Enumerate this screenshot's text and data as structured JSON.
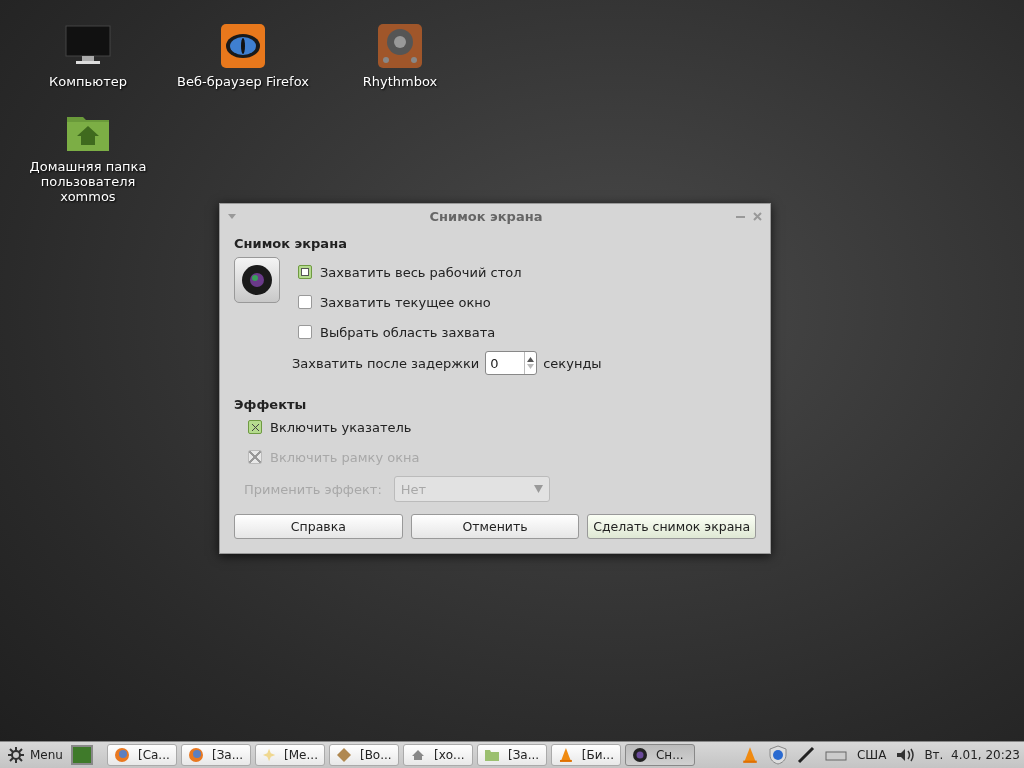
{
  "desktop_icons": [
    {
      "kind": "monitor",
      "label": "Компьютер"
    },
    {
      "kind": "browser",
      "label": "Веб-браузер Firefox"
    },
    {
      "kind": "speaker",
      "label": "Rhythmbox"
    },
    {
      "kind": "home",
      "label": "Домашняя папка пользователя xommos"
    }
  ],
  "dialog": {
    "title": "Снимок экрана",
    "section_capture": "Снимок экрана",
    "capture_options": [
      {
        "label": "Захватить весь рабочий стол",
        "selected": true
      },
      {
        "label": "Захватить текущее окно",
        "selected": false
      },
      {
        "label": "Выбрать область захвата",
        "selected": false
      }
    ],
    "delay_label": "Захватить после задержки",
    "delay_value": "0",
    "delay_unit": "секунды",
    "section_effects": "Эффекты",
    "effects": [
      {
        "label": "Включить указатель",
        "checked": true,
        "disabled": false
      },
      {
        "label": "Включить рамку окна",
        "checked": true,
        "disabled": true
      }
    ],
    "effect_label": "Применить эффект:",
    "effect_value": "Нет",
    "effect_disabled": true,
    "buttons": [
      {
        "label": "Справка",
        "default": false
      },
      {
        "label": "Отменить",
        "default": false
      },
      {
        "label": "Сделать снимок экрана",
        "default": true
      }
    ]
  },
  "taskbar": {
    "menu_label": "Menu",
    "tasks": [
      {
        "kind": "browser",
        "label": "[Са...",
        "selected": false
      },
      {
        "kind": "browser",
        "label": "[За...",
        "selected": false
      },
      {
        "kind": "star",
        "label": "[Ме...",
        "selected": false
      },
      {
        "kind": "package",
        "label": "[Во...",
        "selected": false
      },
      {
        "kind": "home",
        "label": "[хо...",
        "selected": false
      },
      {
        "kind": "folder",
        "label": "[За...",
        "selected": false
      },
      {
        "kind": "cone",
        "label": "[Би...",
        "selected": false
      },
      {
        "kind": "camera",
        "label": "Сн...",
        "selected": true
      }
    ],
    "keyboard_layout": "США",
    "clock": "Вт.  4.01, 20:23"
  }
}
